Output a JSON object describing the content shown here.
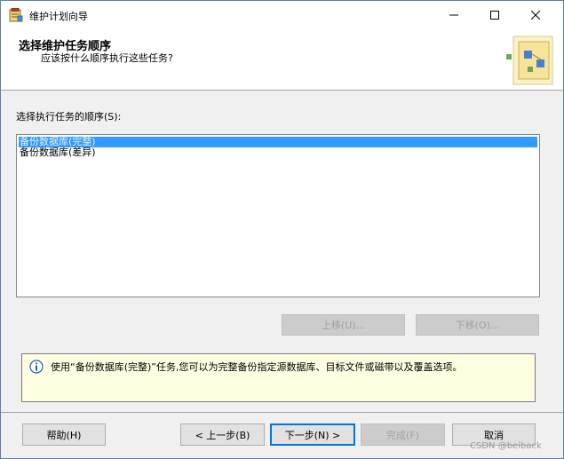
{
  "window": {
    "title": "维护计划向导"
  },
  "header": {
    "title": "选择维护任务顺序",
    "subtitle": "应该按什么顺序执行这些任务?"
  },
  "task_order": {
    "label": "选择执行任务的顺序(S):",
    "items": [
      {
        "label": "备份数据库(完整)",
        "selected": true
      },
      {
        "label": "备份数据库(差异)",
        "selected": false
      }
    ],
    "move_up_label": "上移(U)...",
    "move_down_label": "下移(O)..."
  },
  "info": {
    "text": "使用“备份数据库(完整)”任务,您可以为完整备份指定源数据库、目标文件或磁带以及覆盖选项。"
  },
  "footer": {
    "help_label": "帮助(H)",
    "back_label": "< 上一步(B)",
    "next_label": "下一步(N) >",
    "finish_label": "完成(F)",
    "cancel_label": "取消"
  },
  "watermark": "CSDN @beiback",
  "colors": {
    "selection": "#3399ff",
    "info_background": "#ffffe1",
    "default_button_border": "#0078d7"
  }
}
